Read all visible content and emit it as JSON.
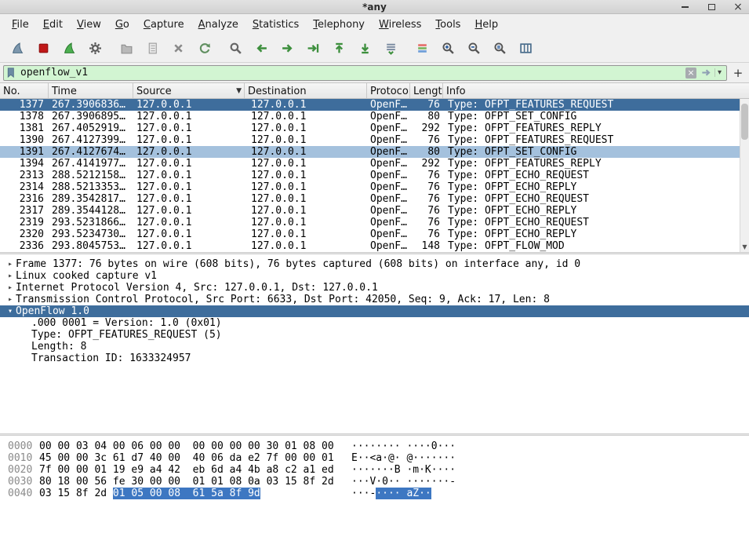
{
  "window": {
    "title": "*any"
  },
  "icons": {
    "close_window": "×",
    "collapsed": "▸",
    "expanded": "▾",
    "sort": "▼",
    "scroll_down": "▼",
    "clear": "×",
    "dropdown": "▾",
    "plus": "+"
  },
  "menu": {
    "items": [
      "File",
      "Edit",
      "View",
      "Go",
      "Capture",
      "Analyze",
      "Statistics",
      "Telephony",
      "Wireless",
      "Tools",
      "Help"
    ]
  },
  "toolbar": {
    "buttons": [
      "start-capture",
      "stop-capture",
      "restart-capture",
      "capture-options",
      "open-file",
      "save-file",
      "close-file",
      "reload",
      "find-packet",
      "go-back",
      "go-forward",
      "go-to-packet",
      "go-to-first",
      "go-to-last",
      "auto-scroll",
      "colorize",
      "zoom-in",
      "zoom-out",
      "zoom-original",
      "resize-columns"
    ]
  },
  "filter": {
    "value": "openflow_v1"
  },
  "packet_list": {
    "columns": [
      "No.",
      "Time",
      "Source",
      "Destination",
      "Protocol",
      "Length",
      "Info"
    ],
    "rows": [
      {
        "no": "1377",
        "time": "267.3906836…",
        "source": "127.0.0.1",
        "destination": "127.0.0.1",
        "protocol": "OpenF…",
        "length": "76",
        "info": "Type: OFPT_FEATURES_REQUEST",
        "state": "selected"
      },
      {
        "no": "1378",
        "time": "267.3906895…",
        "source": "127.0.0.1",
        "destination": "127.0.0.1",
        "protocol": "OpenF…",
        "length": "80",
        "info": "Type: OFPT_SET_CONFIG",
        "state": ""
      },
      {
        "no": "1381",
        "time": "267.4052919…",
        "source": "127.0.0.1",
        "destination": "127.0.0.1",
        "protocol": "OpenF…",
        "length": "292",
        "info": "Type: OFPT_FEATURES_REPLY",
        "state": ""
      },
      {
        "no": "1390",
        "time": "267.4127399…",
        "source": "127.0.0.1",
        "destination": "127.0.0.1",
        "protocol": "OpenF…",
        "length": "76",
        "info": "Type: OFPT_FEATURES_REQUEST",
        "state": ""
      },
      {
        "no": "1391",
        "time": "267.4127674…",
        "source": "127.0.0.1",
        "destination": "127.0.0.1",
        "protocol": "OpenF…",
        "length": "80",
        "info": "Type: OFPT_SET_CONFIG",
        "state": "related"
      },
      {
        "no": "1394",
        "time": "267.4141977…",
        "source": "127.0.0.1",
        "destination": "127.0.0.1",
        "protocol": "OpenF…",
        "length": "292",
        "info": "Type: OFPT_FEATURES_REPLY",
        "state": ""
      },
      {
        "no": "2313",
        "time": "288.5212158…",
        "source": "127.0.0.1",
        "destination": "127.0.0.1",
        "protocol": "OpenF…",
        "length": "76",
        "info": "Type: OFPT_ECHO_REQUEST",
        "state": ""
      },
      {
        "no": "2314",
        "time": "288.5213353…",
        "source": "127.0.0.1",
        "destination": "127.0.0.1",
        "protocol": "OpenF…",
        "length": "76",
        "info": "Type: OFPT_ECHO_REPLY",
        "state": ""
      },
      {
        "no": "2316",
        "time": "289.3542817…",
        "source": "127.0.0.1",
        "destination": "127.0.0.1",
        "protocol": "OpenF…",
        "length": "76",
        "info": "Type: OFPT_ECHO_REQUEST",
        "state": ""
      },
      {
        "no": "2317",
        "time": "289.3544128…",
        "source": "127.0.0.1",
        "destination": "127.0.0.1",
        "protocol": "OpenF…",
        "length": "76",
        "info": "Type: OFPT_ECHO_REPLY",
        "state": ""
      },
      {
        "no": "2319",
        "time": "293.5231866…",
        "source": "127.0.0.1",
        "destination": "127.0.0.1",
        "protocol": "OpenF…",
        "length": "76",
        "info": "Type: OFPT_ECHO_REQUEST",
        "state": ""
      },
      {
        "no": "2320",
        "time": "293.5234730…",
        "source": "127.0.0.1",
        "destination": "127.0.0.1",
        "protocol": "OpenF…",
        "length": "76",
        "info": "Type: OFPT_ECHO_REPLY",
        "state": ""
      },
      {
        "no": "2336",
        "time": "293.8045753…",
        "source": "127.0.0.1",
        "destination": "127.0.0.1",
        "protocol": "OpenF…",
        "length": "148",
        "info": "Type: OFPT_FLOW_MOD",
        "state": ""
      }
    ]
  },
  "detail": {
    "lines": [
      {
        "expander": "collapsed",
        "indent": 0,
        "selected": false,
        "text": "Frame 1377: 76 bytes on wire (608 bits), 76 bytes captured (608 bits) on interface any, id 0"
      },
      {
        "expander": "collapsed",
        "indent": 0,
        "selected": false,
        "text": "Linux cooked capture v1"
      },
      {
        "expander": "collapsed",
        "indent": 0,
        "selected": false,
        "text": "Internet Protocol Version 4, Src: 127.0.0.1, Dst: 127.0.0.1"
      },
      {
        "expander": "collapsed",
        "indent": 0,
        "selected": false,
        "text": "Transmission Control Protocol, Src Port: 6633, Dst Port: 42050, Seq: 9, Ack: 17, Len: 8"
      },
      {
        "expander": "expanded",
        "indent": 0,
        "selected": true,
        "text": "OpenFlow 1.0"
      },
      {
        "expander": "",
        "indent": 1,
        "selected": false,
        "text": ".000 0001 = Version: 1.0 (0x01)"
      },
      {
        "expander": "",
        "indent": 1,
        "selected": false,
        "text": "Type: OFPT_FEATURES_REQUEST (5)"
      },
      {
        "expander": "",
        "indent": 1,
        "selected": false,
        "text": "Length: 8"
      },
      {
        "expander": "",
        "indent": 1,
        "selected": false,
        "text": "Transaction ID: 1633324957"
      }
    ]
  },
  "hex": {
    "rows": [
      {
        "offset": "0000",
        "hex": "00 00 03 04 00 06 00 00  00 00 00 00 30 01 08 00",
        "hex_sel": "",
        "ascii": "········ ····0···",
        "ascii_sel": ""
      },
      {
        "offset": "0010",
        "hex": "45 00 00 3c 61 d7 40 00  40 06 da e2 7f 00 00 01",
        "hex_sel": "",
        "ascii": "E··<a·@· @·······",
        "ascii_sel": ""
      },
      {
        "offset": "0020",
        "hex": "7f 00 00 01 19 e9 a4 42  eb 6d a4 4b a8 c2 a1 ed",
        "hex_sel": "",
        "ascii": "·······B ·m·K····",
        "ascii_sel": ""
      },
      {
        "offset": "0030",
        "hex": "80 18 00 56 fe 30 00 00  01 01 08 0a 03 15 8f 2d",
        "hex_sel": "",
        "ascii": "···V·0·· ·······-",
        "ascii_sel": ""
      },
      {
        "offset": "0040",
        "hex": "03 15 8f 2d ",
        "hex_sel": "01 05 00 08  61 5a 8f 9d",
        "ascii": "···-",
        "ascii_sel": "···· aZ··"
      }
    ]
  },
  "colors": {
    "selection": "#3e6d9c",
    "related_row": "#a4c1dd",
    "filter_valid_bg": "#d2f5d2",
    "hex_selection": "#3d77c2"
  }
}
